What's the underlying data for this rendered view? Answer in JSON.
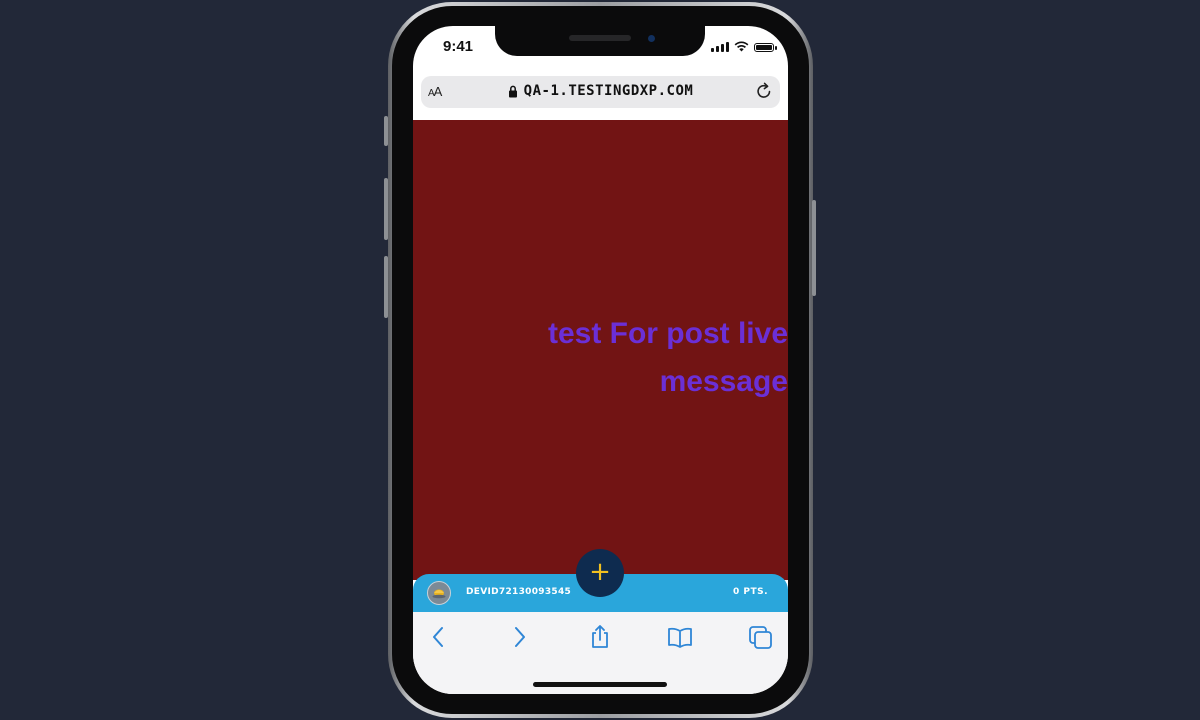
{
  "status_bar": {
    "time": "9:41"
  },
  "browser": {
    "text_size_label": "AA",
    "url": "QA-1.TESTINGDXP.COM"
  },
  "page": {
    "background_color": "#721414",
    "headline": "test For post live message",
    "headline_color": "#6b2fd6"
  },
  "user_bar": {
    "username": "DEVID72130093545",
    "points": "0 PTS."
  },
  "fab": {
    "label": "+"
  },
  "toolbar": {
    "icons": [
      "back-icon",
      "forward-icon",
      "share-icon",
      "bookmarks-icon",
      "tabs-icon"
    ]
  }
}
